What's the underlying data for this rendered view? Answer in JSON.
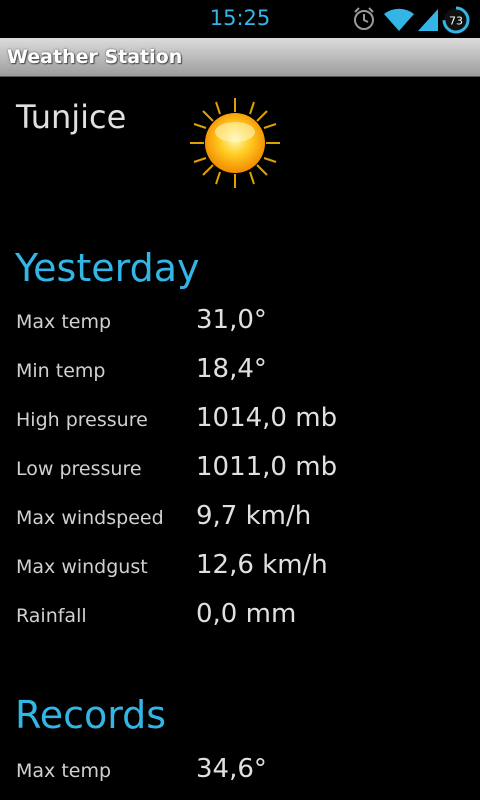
{
  "status_bar": {
    "time": "15:25",
    "battery": "73",
    "icons": [
      "alarm-icon",
      "wifi-icon",
      "signal-icon",
      "battery-icon"
    ]
  },
  "app": {
    "title": "Weather Station"
  },
  "location": {
    "name": "Tunjice",
    "icon": "sun-icon"
  },
  "yesterday": {
    "heading": "Yesterday",
    "rows": [
      {
        "label": "Max temp",
        "value": "31,0°"
      },
      {
        "label": "Min temp",
        "value": "18,4°"
      },
      {
        "label": "High pressure",
        "value": "1014,0 mb"
      },
      {
        "label": "Low pressure",
        "value": "1011,0 mb"
      },
      {
        "label": "Max windspeed",
        "value": "9,7 km/h"
      },
      {
        "label": "Max windgust",
        "value": "12,6 km/h"
      },
      {
        "label": "Rainfall",
        "value": "0,0 mm"
      }
    ]
  },
  "records": {
    "heading": "Records",
    "rows": [
      {
        "label": "Max temp",
        "value": "34,6°"
      }
    ]
  },
  "colors": {
    "accent": "#33b5e5",
    "background": "#000000",
    "text": "#dcdcdc"
  }
}
